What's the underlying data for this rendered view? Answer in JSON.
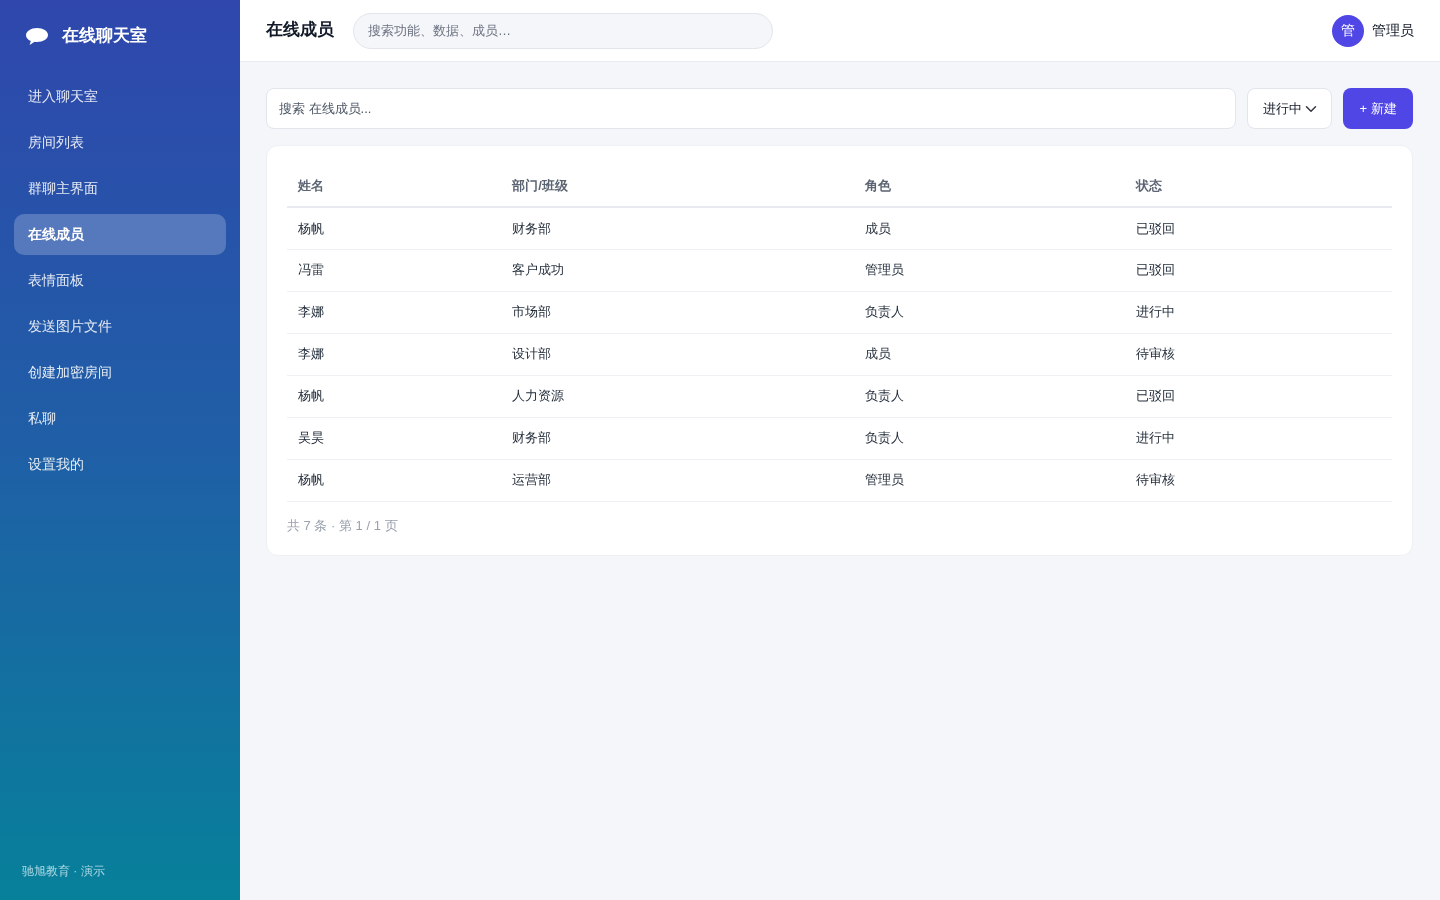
{
  "sidebar": {
    "brand": "在线聊天室",
    "items": [
      {
        "label": "进入聊天室",
        "selected": false
      },
      {
        "label": "房间列表",
        "selected": false
      },
      {
        "label": "群聊主界面",
        "selected": false
      },
      {
        "label": "在线成员",
        "selected": true
      },
      {
        "label": "表情面板",
        "selected": false
      },
      {
        "label": "发送图片文件",
        "selected": false
      },
      {
        "label": "创建加密房间",
        "selected": false
      },
      {
        "label": "私聊",
        "selected": false
      },
      {
        "label": "设置我的",
        "selected": false
      }
    ],
    "footer": "驰旭教育 · 演示"
  },
  "topbar": {
    "title": "在线成员",
    "search": {
      "placeholder": "搜索功能、数据、成员…"
    },
    "user": {
      "avatar": "管",
      "name": "管理员"
    }
  },
  "toolbar": {
    "search": {
      "placeholder": "搜索 在线成员..."
    },
    "filter": {
      "value": "进行中"
    },
    "new_button": "+ 新建"
  },
  "table": {
    "columns": [
      "姓名",
      "部门/班级",
      "角色",
      "状态"
    ],
    "rows": [
      [
        "杨帆",
        "财务部",
        "成员",
        "已驳回"
      ],
      [
        "冯雷",
        "客户成功",
        "管理员",
        "已驳回"
      ],
      [
        "李娜",
        "市场部",
        "负责人",
        "进行中"
      ],
      [
        "李娜",
        "设计部",
        "成员",
        "待审核"
      ],
      [
        "杨帆",
        "人力资源",
        "负责人",
        "已驳回"
      ],
      [
        "吴昊",
        "财务部",
        "负责人",
        "进行中"
      ],
      [
        "杨帆",
        "运营部",
        "管理员",
        "待审核"
      ]
    ]
  },
  "pagination": "共 7 条 · 第 1 / 1 页"
}
